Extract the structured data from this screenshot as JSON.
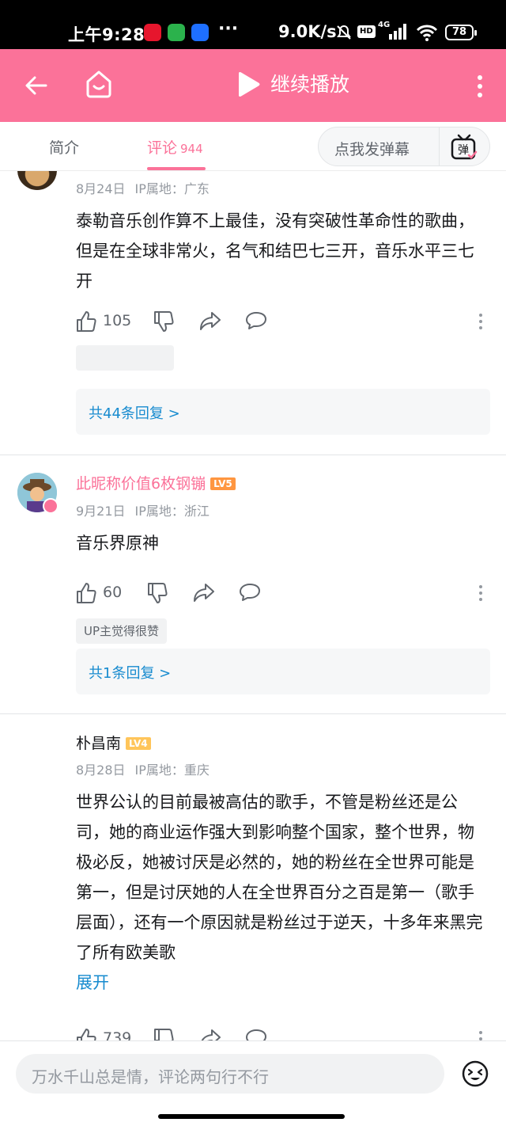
{
  "status_bar": {
    "time": "上午9:28",
    "net_speed": "9.0K/s",
    "hd_label": "HD",
    "network": "4G",
    "battery": "78"
  },
  "top_bar": {
    "title": "继续播放"
  },
  "tabs": {
    "intro": "简介",
    "comments": "评论",
    "comments_count": "944",
    "danmaku_placeholder": "点我发弹幕",
    "danmaku_icon_text": "弹"
  },
  "comments": [
    {
      "date": "8月24日",
      "ip": "IP属地：广东",
      "body": "泰勒音乐创作算不上最佳，没有突破性革命性的歌曲，但是在全球非常火，名气和结巴七三开，音乐水平三七开",
      "likes": "105",
      "replies": "共44条回复 >"
    },
    {
      "username": "此昵称价值6枚钢镚",
      "level": "LV5",
      "date": "9月21日",
      "ip": "IP属地：浙江",
      "body": "音乐界原神",
      "likes": "60",
      "up_badge": "UP主觉得很赞",
      "replies": "共1条回复 >"
    },
    {
      "username": "朴昌南",
      "level": "LV4",
      "date": "8月28日",
      "ip": "IP属地：重庆",
      "body": "世界公认的目前最被高估的歌手，不管是粉丝还是公司，她的商业运作强大到影响整个国家，整个世界，物极必反，她被讨厌是必然的，她的粉丝在全世界可能是第一，但是讨厌她的人在全世界百分之百是第一（歌手层面），还有一个原因就是粉丝过于逆天，十多年来黑完了所有欧美歌",
      "expand": "展开",
      "likes": "739"
    }
  ],
  "bottom_bar": {
    "placeholder": "万水千山总是情，评论两句行不行"
  },
  "colors": {
    "brand_pink": "#fb7299",
    "link_blue": "#178bcf",
    "lv5": "#ff9640",
    "lv4": "#ffc55a"
  }
}
